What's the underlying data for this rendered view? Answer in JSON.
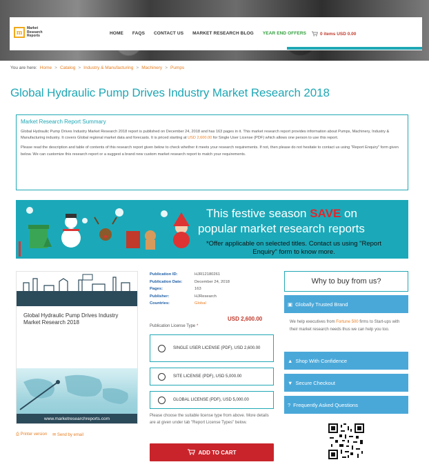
{
  "brand": {
    "logo_letter": "m",
    "logo_text": "Market Research Reports"
  },
  "nav": {
    "items": [
      "HOME",
      "FAQS",
      "CONTACT US",
      "MARKET RESEARCH BLOG",
      "YEAR END OFFERS"
    ],
    "cart": "0 items USD 0.00"
  },
  "breadcrumb": {
    "prefix": "You are here:",
    "items": [
      "Home",
      "Catalog",
      "Industry & Manufacturing",
      "Machinery",
      "Pumps"
    ],
    "separator": ">"
  },
  "page_title": "Global Hydraulic Pump Drives Industry Market Research 2018",
  "summary": {
    "title": "Market Research Report Summary",
    "p1_a": "Global Hydraulic Pump Drives Industry Market Research 2018 report is published on December 24, 2018 and has 163 pages in it. This market research report provides information about Pumps, Machinery, Industry & Manufacturing industry. It covers Global regional market data and forecasts. It is priced starting at",
    "p1_price": "USD 2,600.00",
    "p1_b": "for Single User License (PDF) which allows one person to use this report.",
    "p2": "Please read the description and table of contents of this research report given below to check whether it meets your research requirements. If not, then please do not hesitate to contact us using \"Report Enquiry\" form given below. We can customize this research report or a suggest a brand new custom market research report to match your requirements."
  },
  "banner": {
    "line1_a": "This festive season",
    "line1_save": "SAVE",
    "line1_b": "on",
    "line2": "popular market research reports",
    "line3": "*Offer applicable on selected titles. Contact us using \"Report Enquiry\" form to know more."
  },
  "product_image": {
    "title": "Global Hydraulic Pump Drives Industry Market Research 2018",
    "footer": "www.marketresearchreports.com"
  },
  "links": {
    "printer": "Printer version",
    "email": "Send by email"
  },
  "meta": {
    "rows": [
      {
        "k": "Publication ID:",
        "v": "HJR12180261"
      },
      {
        "k": "Publication Date:",
        "v": "December 24, 2018"
      },
      {
        "k": "Pages:",
        "v": "163"
      },
      {
        "k": "Publisher:",
        "v": "HJResearch"
      },
      {
        "k": "Countries:",
        "v": "Global"
      }
    ],
    "price": "USD 2,600.00",
    "license_label": "Publication License Type",
    "required_mark": "*"
  },
  "licenses": [
    "SINGLE USER LICENSE (PDF), USD 2,600.00",
    "SITE LICENSE (PDF), USD 5,000.00",
    "GLOBAL LICENSE (PDF), USD 5,000.00"
  ],
  "choose_text": "Please choose the suitable license type from above. More details are at given under tab \"Report License Types\" below.",
  "add_to_cart": "ADD TO CART",
  "sidebar": {
    "why_title": "Why to buy from us?",
    "trusted": "Globally Trusted Brand",
    "trusted_body_a": "We help executives from",
    "trusted_body_link": "Fortune 500",
    "trusted_body_b": "firms to Start-ups with their market research needs thus we can help you too.",
    "shop": "Shop With Confidence",
    "checkout": "Secure Checkout",
    "faq": "Frequently Asked Questions"
  },
  "colors": {
    "accent": "#1fa7b5",
    "orange": "#e67e22",
    "red": "#c9242b",
    "blue": "#4aa8d9"
  }
}
